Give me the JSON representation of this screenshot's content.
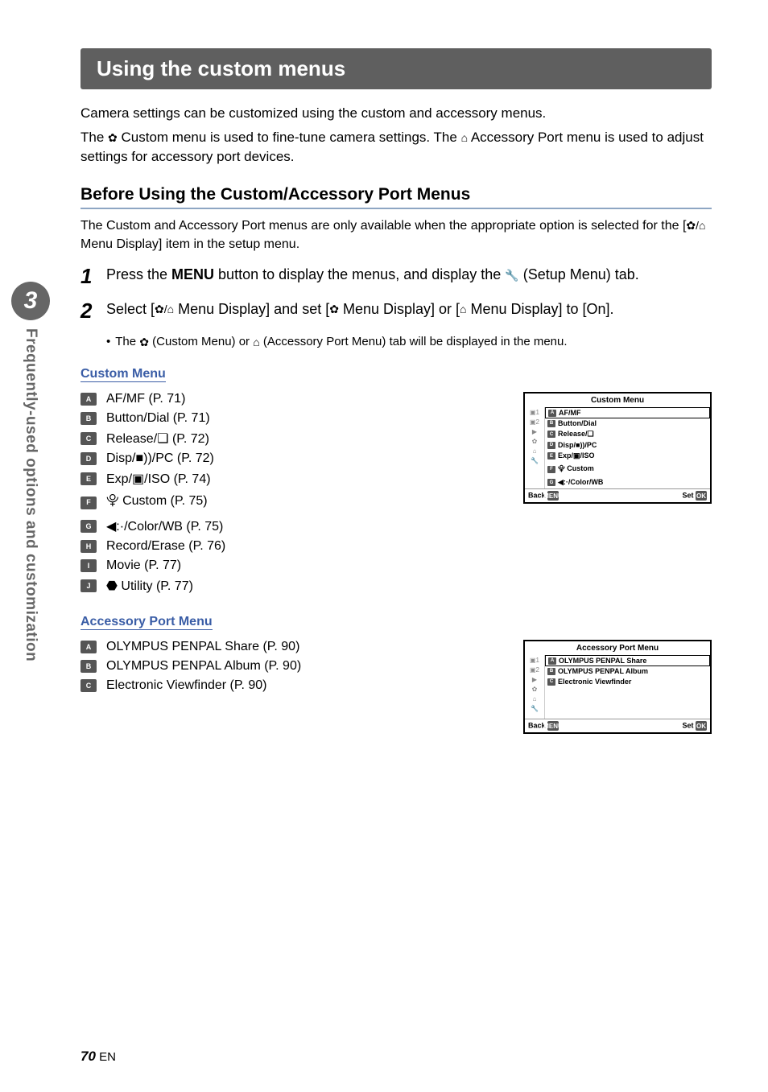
{
  "chapter": {
    "number": "3",
    "title": "Frequently-used options and customization"
  },
  "title": "Using the custom menus",
  "intro": {
    "p1": "Camera settings can be customized using the custom and accessory menus.",
    "p2a": "The ",
    "p2b": " Custom menu is used to fine-tune camera settings. The ",
    "p2c": " Accessory Port menu is used to adjust settings for accessory port devices."
  },
  "before": {
    "heading": "Before Using the Custom/Accessory Port Menus",
    "note_a": "The Custom and Accessory Port menus are only available when the appropriate option is selected for the [",
    "note_b": " Menu Display] item in the setup menu."
  },
  "steps": {
    "s1": {
      "a": "Press the ",
      "menu": "MENU",
      "b": " button to display the menus, and display the ",
      "c": " (Setup Menu) tab."
    },
    "s2": {
      "a": "Select [",
      "b": " Menu Display] and set [",
      "c": " Menu Display] or [",
      "d": " Menu Display] to [On].",
      "bullet_a": "The ",
      "bullet_b": " (Custom Menu) or ",
      "bullet_c": " (Accessory Port Menu) tab will be displayed in the menu."
    }
  },
  "custom_menu": {
    "label": "Custom Menu",
    "items": [
      {
        "icon": "A",
        "text": "AF/MF (P. 71)"
      },
      {
        "icon": "B",
        "text": "Button/Dial (P. 71)"
      },
      {
        "icon": "C",
        "text": "Release/❏ (P. 72)"
      },
      {
        "icon": "D",
        "text": "Disp/■))/PC (P. 72)"
      },
      {
        "icon": "E",
        "text": "Exp/▣/ISO (P. 74)"
      },
      {
        "icon": "F",
        "text": "⯓ Custom (P. 75)"
      },
      {
        "icon": "G",
        "text": "◀:·/Color/WB (P. 75)"
      },
      {
        "icon": "H",
        "text": "Record/Erase (P. 76)"
      },
      {
        "icon": "I",
        "text": "Movie (P. 77)"
      },
      {
        "icon": "J",
        "text": "⬣ Utility (P. 77)"
      }
    ]
  },
  "accessory_menu": {
    "label": "Accessory Port Menu",
    "items": [
      {
        "icon": "A",
        "text": "OLYMPUS PENPAL Share (P. 90)"
      },
      {
        "icon": "B",
        "text": "OLYMPUS PENPAL Album (P. 90)"
      },
      {
        "icon": "C",
        "text": "Electronic Viewfinder (P. 90)"
      }
    ]
  },
  "screenshot_custom": {
    "title": "Custom Menu",
    "rows": [
      "AF/MF",
      "Button/Dial",
      "Release/❏",
      "Disp/■))/PC",
      "Exp/▣/ISO",
      "⯓ Custom",
      "◀:·/Color/WB"
    ],
    "back": "Back",
    "set": "Set"
  },
  "screenshot_accessory": {
    "title": "Accessory Port Menu",
    "rows": [
      "OLYMPUS PENPAL Share",
      "OLYMPUS PENPAL Album",
      "Electronic Viewfinder"
    ],
    "back": "Back",
    "set": "Set"
  },
  "glyphs": {
    "gear": "✿",
    "port": "⌂",
    "wrench": "🔧",
    "gear_port": "✿/⌂"
  },
  "footer": {
    "page": "70",
    "lang": "EN"
  },
  "chart_data": null
}
